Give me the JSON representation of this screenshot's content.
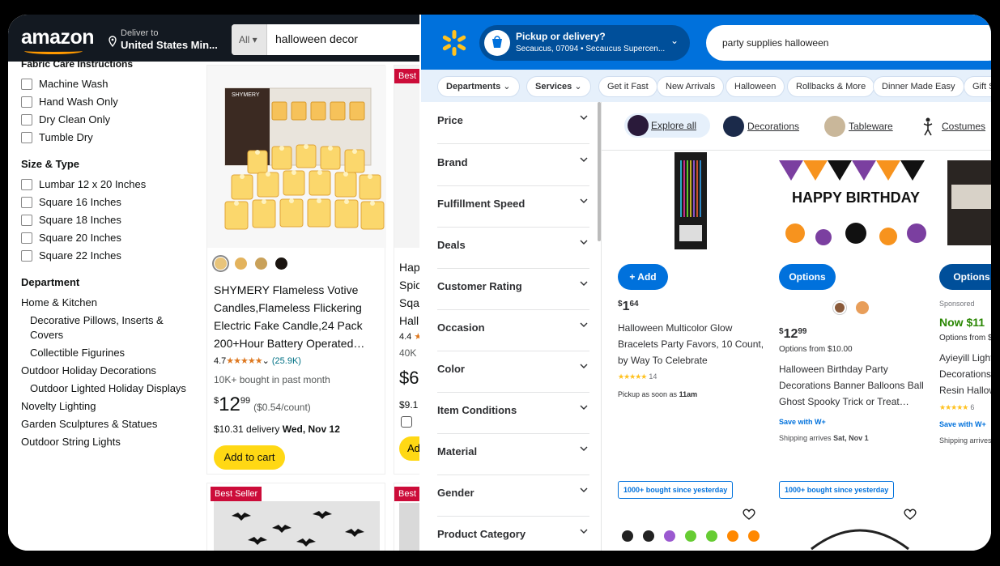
{
  "amazon": {
    "logo": "amazon",
    "deliver_line1": "Deliver to",
    "deliver_line2": "United States Min...",
    "search_category": "All",
    "search_query": "halloween decor",
    "sidebar": {
      "partial_heading": "Fabric Care Instructions",
      "fabric_care": [
        "Machine Wash",
        "Hand Wash Only",
        "Dry Clean Only",
        "Tumble Dry"
      ],
      "size_heading": "Size & Type",
      "sizes": [
        "Lumbar 12 x 20 Inches",
        "Square 16 Inches",
        "Square 18 Inches",
        "Square 20 Inches",
        "Square 22 Inches"
      ],
      "department_heading": "Department",
      "departments": [
        "Home & Kitchen",
        "Decorative Pillows, Inserts &",
        "Covers",
        "Collectible Figurines",
        "Outdoor Holiday Decorations",
        "Outdoor Lighted Holiday Displays",
        "Novelty Lighting",
        "Garden Sculptures & Statues",
        "Outdoor String Lights"
      ]
    },
    "product": {
      "brand_on_box": "SHYMERY",
      "title": "SHYMERY Flameless Votive Candles,Flameless Flickering Electric Fake Candle,24 Pack 200+Hour Battery Operated…",
      "rating": "4.7",
      "stars": "★★★★★",
      "rating_count": "(25.9K)",
      "bought": "10K+ bought in past month",
      "price_symbol": "$",
      "price_whole": "12",
      "price_fraction": "99",
      "unit_price": "($0.54/count)",
      "delivery_price": "$10.31 delivery",
      "delivery_date": "Wed, Nov 12",
      "add_to_cart": "Add to cart",
      "swatch_colors": [
        "#e8c47a",
        "#e3b35d",
        "#c9a15a",
        "#1a1410"
      ]
    },
    "partial_card": {
      "badge": "Best",
      "lines": [
        "Hap",
        "Spic",
        "Sqa",
        "Hall"
      ],
      "rating": "4.4",
      "bought": "40K",
      "price": "$6",
      "delivery": "$9.1",
      "add": "Ad"
    },
    "bottom_badges": [
      "Best Seller",
      "Best"
    ]
  },
  "walmart": {
    "pickup_title": "Pickup or delivery?",
    "pickup_location": "Secaucus, 07094 • Secaucus Supercen...",
    "search_query": "party supplies halloween",
    "nav": [
      "Departments",
      "Services",
      "Get it Fast",
      "New Arrivals",
      "Halloween",
      "Rollbacks & More",
      "Dinner Made Easy",
      "Gift Sh"
    ],
    "filters": [
      "Price",
      "Brand",
      "Fulfillment Speed",
      "Deals",
      "Customer Rating",
      "Occasion",
      "Color",
      "Item Conditions",
      "Material",
      "Gender",
      "Product Category"
    ],
    "categories": [
      "Explore all",
      "Decorations",
      "Tableware",
      "Costumes"
    ],
    "products": [
      {
        "button": "+ Add",
        "price_symbol": "$",
        "price_whole": "1",
        "price_fraction": "64",
        "name": "Halloween Multicolor Glow Bracelets Party Favors, 10 Count, by Way To Celebrate",
        "stars": "★★★★★",
        "reviews": "14",
        "pickup_label": "Pickup as soon as",
        "pickup_time": "11am"
      },
      {
        "button": "Options",
        "price_symbol": "$",
        "price_whole": "12",
        "price_fraction": "99",
        "options_from": "Options from $10.00",
        "banner_text": "HAPPY BIRTHDAY",
        "name": "Halloween Birthday Party Decorations Banner Balloons Ball Ghost Spooky Trick or Treat…",
        "save_with": "Save with",
        "wplus": "W+",
        "shipping_label": "Shipping arrives",
        "shipping_date": "Sat, Nov 1"
      },
      {
        "button": "Options",
        "sponsored": "Sponsored",
        "now": "Now",
        "price": "$11",
        "options_from": "Options from $",
        "name_lines": [
          "Ayieyill Light",
          "Decorations",
          "Resin Hallow"
        ],
        "stars": "★★★★★",
        "reviews": "6",
        "save_with": "Save with",
        "wplus": "W+",
        "shipping": "Shipping arrives"
      }
    ],
    "bought_badge": "1000+ bought since yesterday",
    "accent": "#0071dc"
  }
}
